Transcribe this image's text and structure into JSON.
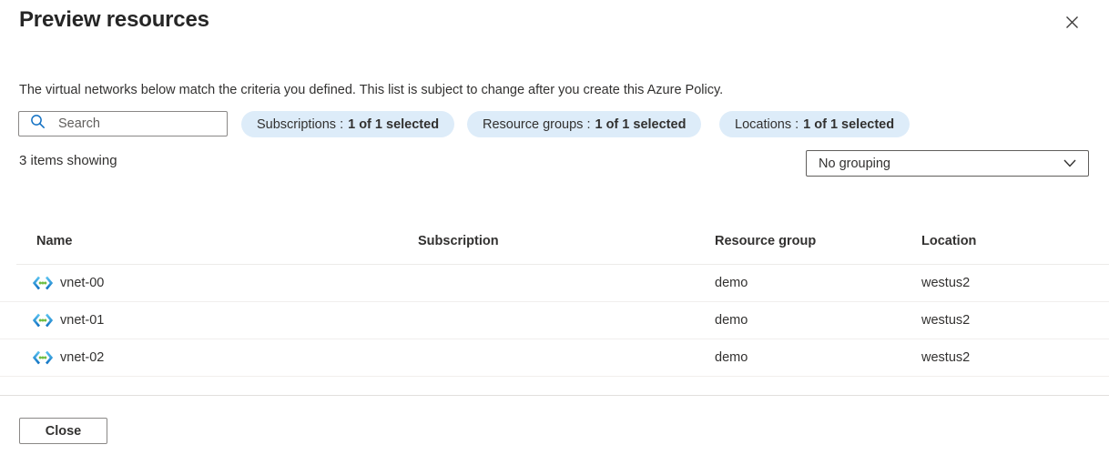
{
  "panel": {
    "title": "Preview resources",
    "description": "The virtual networks below match the criteria you defined. This list is subject to change after you create this Azure Policy."
  },
  "toolbar": {
    "search_placeholder": "Search",
    "filters": [
      {
        "label": "Subscriptions :",
        "value": "1 of 1 selected"
      },
      {
        "label": "Resource groups :",
        "value": "1 of 1 selected"
      },
      {
        "label": "Locations :",
        "value": "1 of 1 selected"
      }
    ]
  },
  "summary": {
    "items_showing": "3 items showing"
  },
  "grouping": {
    "selected": "No grouping"
  },
  "table": {
    "columns": [
      "Name",
      "Subscription",
      "Resource group",
      "Location"
    ],
    "rows": [
      {
        "icon": "virtual-network-icon",
        "name": "vnet-00",
        "subscription": "",
        "resource_group": "demo",
        "location": "westus2"
      },
      {
        "icon": "virtual-network-icon",
        "name": "vnet-01",
        "subscription": "",
        "resource_group": "demo",
        "location": "westus2"
      },
      {
        "icon": "virtual-network-icon",
        "name": "vnet-02",
        "subscription": "",
        "resource_group": "demo",
        "location": "westus2"
      }
    ]
  },
  "footer": {
    "close_label": "Close"
  },
  "colors": {
    "accent": "#0078d4",
    "pill_background": "#ddecf9",
    "search_icon": "#1170c3",
    "vnet_blue_light": "#59c2f0",
    "vnet_blue_dark": "#1273c3",
    "vnet_green": "#6fbe44",
    "divider": "#edebe9",
    "text_primary": "#323130"
  }
}
